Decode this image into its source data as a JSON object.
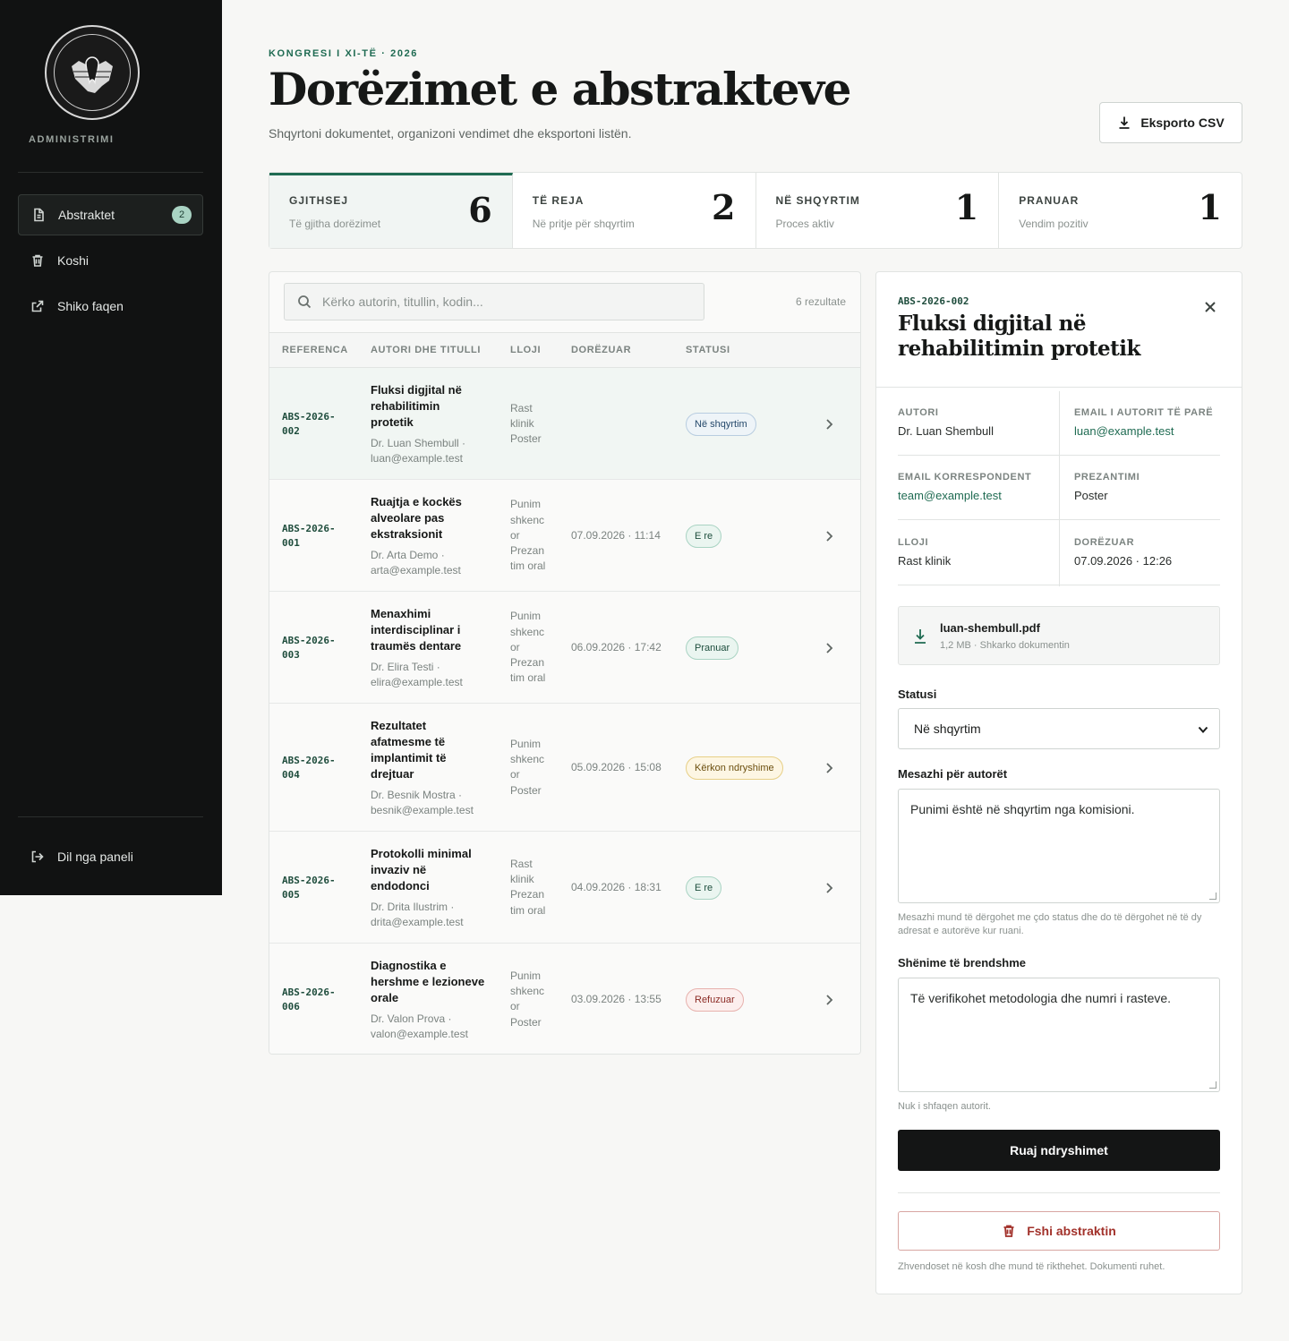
{
  "sidebar": {
    "brand": "ADMINISTRIMI",
    "items": [
      {
        "label": "Abstraktet",
        "icon": "document-icon",
        "badge": "2",
        "active": true
      },
      {
        "label": "Koshi",
        "icon": "trash-icon"
      },
      {
        "label": "Shiko faqen",
        "icon": "external-link-icon"
      }
    ],
    "logout": "Dil nga paneli"
  },
  "header": {
    "eyebrow": "KONGRESI I XI-TË · 2026",
    "title": "Dorëzimet e abstrakteve",
    "subtitle": "Shqyrtoni dokumentet, organizoni vendimet dhe eksportoni listën.",
    "export_label": "Eksporto CSV"
  },
  "stats": [
    {
      "label": "GJITHSEJ",
      "desc": "Të gjitha dorëzimet",
      "value": "6"
    },
    {
      "label": "TË REJA",
      "desc": "Në pritje për shqyrtim",
      "value": "2"
    },
    {
      "label": "NË SHQYRTIM",
      "desc": "Proces aktiv",
      "value": "1"
    },
    {
      "label": "PRANUAR",
      "desc": "Vendim pozitiv",
      "value": "1"
    }
  ],
  "list": {
    "search_placeholder": "Kërko autorin, titullin, kodin...",
    "results": "6 rezultate",
    "columns": [
      "REFERENCA",
      "AUTORI DHE TITULLI",
      "LLOJI",
      "DORËZUAR",
      "STATUSI"
    ],
    "rows": [
      {
        "ref": [
          "ABS-2026-",
          "002"
        ],
        "title": [
          "Fluksi digjital në",
          "rehabilitimin",
          "protetik"
        ],
        "author": [
          "Dr. Luan Shembull ·",
          "luan@example.test"
        ],
        "type": [
          "Rast",
          "klinik",
          "Poster"
        ],
        "date": "",
        "status": "Në shqyrtim",
        "status_kind": "review"
      },
      {
        "ref": [
          "ABS-2026-",
          "001"
        ],
        "title": [
          "Ruajtja e kockës",
          "alveolare pas",
          "ekstraksionit"
        ],
        "author": [
          "Dr. Arta Demo ·",
          "arta@example.test"
        ],
        "type": [
          "Punim",
          "shkenc",
          "or",
          "Prezan",
          "tim oral"
        ],
        "date": "07.09.2026 · 11:14",
        "status": "E re",
        "status_kind": "new"
      },
      {
        "ref": [
          "ABS-2026-",
          "003"
        ],
        "title": [
          "Menaxhimi",
          "interdisciplinar i",
          "traumës dentare"
        ],
        "author": [
          "Dr. Elira Testi ·",
          "elira@example.test"
        ],
        "type": [
          "Punim",
          "shkenc",
          "or",
          "Prezan",
          "tim oral"
        ],
        "date": "06.09.2026 · 17:42",
        "status": "Pranuar",
        "status_kind": "accepted"
      },
      {
        "ref": [
          "ABS-2026-",
          "004"
        ],
        "title": [
          "Rezultatet",
          "afatmesme të",
          "implantimit të",
          "drejtuar"
        ],
        "author": [
          "Dr. Besnik Mostra ·",
          "besnik@example.test"
        ],
        "type": [
          "Punim",
          "shkenc",
          "or",
          "Poster"
        ],
        "date": "05.09.2026 · 15:08",
        "status": "Kërkon ndryshime",
        "status_kind": "changes"
      },
      {
        "ref": [
          "ABS-2026-",
          "005"
        ],
        "title": [
          "Protokolli minimal",
          "invaziv në",
          "endodonci"
        ],
        "author": [
          "Dr. Drita Ilustrim ·",
          "drita@example.test"
        ],
        "type": [
          "Rast",
          "klinik",
          "Prezan",
          "tim oral"
        ],
        "date": "04.09.2026 · 18:31",
        "status": "E re",
        "status_kind": "new"
      },
      {
        "ref": [
          "ABS-2026-",
          "006"
        ],
        "title": [
          "Diagnostika e",
          "hershme e lezioneve",
          "orale"
        ],
        "author": [
          "Dr. Valon Prova ·",
          "valon@example.test"
        ],
        "type": [
          "Punim",
          "shkenc",
          "or",
          "Poster"
        ],
        "date": "03.09.2026 · 13:55",
        "status": "Refuzuar",
        "status_kind": "rejected"
      }
    ]
  },
  "detail": {
    "ref": "ABS-2026-002",
    "title": "Fluksi digjital në rehabilitimin protetik",
    "fields": [
      {
        "label": "AUTORI",
        "value": "Dr. Luan Shembull"
      },
      {
        "label": "EMAIL I AUTORIT TË PARË",
        "value": "luan@example.test"
      },
      {
        "label": "EMAIL KORRESPONDENT",
        "value": "team@example.test"
      },
      {
        "label": "PREZANTIMI",
        "value": "Poster"
      },
      {
        "label": "LLOJI",
        "value": "Rast klinik"
      },
      {
        "label": "DORËZUAR",
        "value": "07.09.2026 · 12:26"
      }
    ],
    "file_name": "luan-shembull.pdf",
    "file_meta": "1,2 MB · Shkarko dokumentin",
    "status_label": "Statusi",
    "status_value": "Në shqyrtim",
    "message_label": "Mesazhi për autorët",
    "message_value": "Punimi është në shqyrtim nga komisioni.",
    "message_hint": "Mesazhi mund të dërgohet me çdo status dhe do të dërgohet në të dy adresat e autorëve kur ruani.",
    "notes_label": "Shënime të brendshme",
    "notes_value": "Të verifikohet metodologia dhe numri i rasteve.",
    "notes_hint": "Nuk i shfaqen autorit.",
    "save_label": "Ruaj ndryshimet",
    "delete_label": "Fshi abstraktin",
    "delete_hint": "Zhvendoset në kosh dhe mund të rikthehet. Dokumenti ruhet."
  },
  "colors": {
    "accent": "#1f6b52",
    "sidebar": "#111212",
    "danger": "#a2322b"
  }
}
